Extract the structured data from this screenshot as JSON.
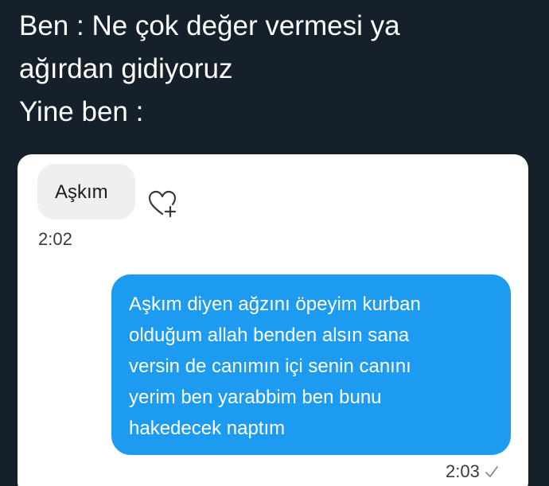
{
  "caption": {
    "lines": [
      "Ben : Ne çok değer vermesi ya",
      "ağırdan gidiyoruz",
      "Yine ben :"
    ]
  },
  "chat": {
    "incoming": {
      "text": "Aşkım",
      "time": "2:02",
      "react_icon": "heart-plus-icon"
    },
    "outgoing": {
      "lines": [
        "Aşkım diyen ağzını öpeyim kurban",
        "olduğum allah benden alsın sana",
        "versin de canımın içi senin canını",
        "yerim ben yarabbim ben bunu",
        "hakedecek naptım"
      ],
      "time": "2:03",
      "status_icon": "check-icon"
    }
  },
  "colors": {
    "background": "#15202b",
    "outgoing_bubble": "#1d9bf0",
    "incoming_bubble": "#efefef"
  }
}
